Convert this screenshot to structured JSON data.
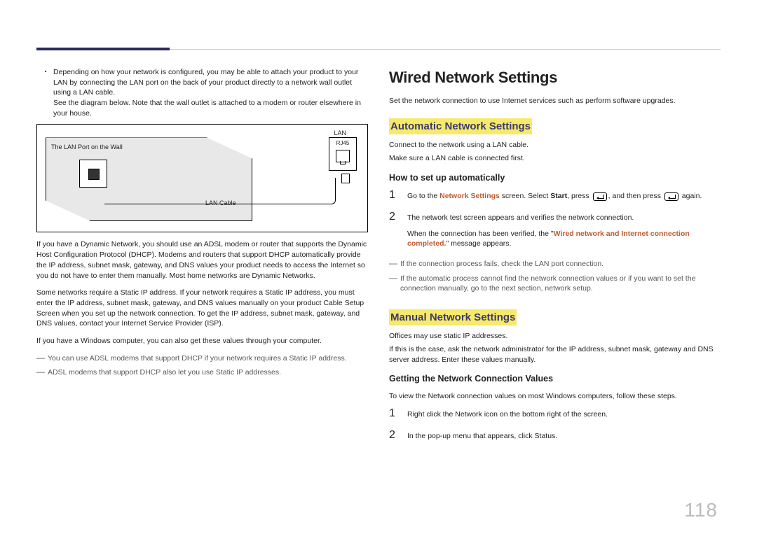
{
  "page_number": "118",
  "left": {
    "bullet": "Depending on how your network is configured, you may be able to attach your product to your LAN by connecting the LAN port on the back of your product directly to a network wall outlet using a LAN cable.",
    "bullet_sub": "See the diagram below. Note that the wall outlet is attached to a modem or router elsewhere in your house.",
    "diag": {
      "lan": "LAN",
      "rj45": "RJ45",
      "wall_label": "The LAN Port on the Wall",
      "cable_label": "LAN Cable"
    },
    "p1": "If you have a Dynamic Network, you should use an ADSL modem or router that supports the Dynamic Host Configuration Protocol (DHCP). Modems and routers that support DHCP automatically provide the IP address, subnet mask, gateway, and DNS values your product needs to access the Internet so you do not have to enter them manually. Most home networks are Dynamic Networks.",
    "p2": "Some networks require a Static IP address. If your network requires a Static IP address, you must enter the IP address, subnet mask, gateway, and DNS values manually on your product Cable Setup Screen when you set up the network connection. To get the IP address, subnet mask, gateway, and DNS values, contact your Internet Service Provider (ISP).",
    "p3": "If you have a Windows computer, you can also get these values through your computer.",
    "note1": "You can use ADSL modems that support DHCP if your network requires a Static IP address.",
    "note2": "ADSL modems that support DHCP also let you use Static IP addresses."
  },
  "right": {
    "h2": "Wired Network Settings",
    "intro": "Set the network connection to use Internet services such as perform software upgrades.",
    "auto": {
      "heading": "Automatic Network Settings",
      "l1": "Connect to the network using a LAN cable.",
      "l2": "Make sure a LAN cable is connected first.",
      "howto": "How to set up automatically",
      "step1_a": "Go to the ",
      "step1_ns": "Network Settings",
      "step1_b": " screen. Select ",
      "step1_start": "Start",
      "step1_c": ", press ",
      "step1_d": ", and then press ",
      "step1_e": " again.",
      "step2": "The network test screen appears and verifies the network connection.",
      "step2b_a": "When the connection has been verified, the \"",
      "step2b_accent": "Wired network and Internet connection completed.",
      "step2b_b": "\" message appears.",
      "note1": "If the connection process fails, check the LAN port connection.",
      "note2": "If the automatic process cannot find the network connection values or if you want to set the connection manually, go to the next section, network setup."
    },
    "manual": {
      "heading": "Manual Network Settings",
      "l1": "Offices may use static IP addresses.",
      "l2": "If this is the case, ask the network administrator for the IP address, subnet mask, gateway and DNS server address. Enter these values manually.",
      "howto": "Getting the Network Connection Values",
      "intro2": "To view the Network connection values on most Windows computers, follow these steps.",
      "step1": "Right click the Network icon on the bottom right of the screen.",
      "step2": "In the pop-up menu that appears, click Status."
    }
  }
}
